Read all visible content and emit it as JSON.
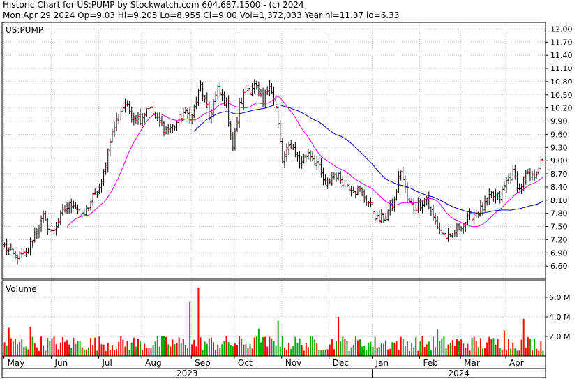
{
  "header": {
    "line1": "Historic Chart for US:PUMP by Stockwatch.com 604.687.1500 - (c) 2024",
    "line2": "Mon Apr 29 2024  Op=9.03  Hi=9.205  Lo=8.955  Cl=9.00  Vol=1,372,033  Year hi=11.37  lo=6.33"
  },
  "chart_data": {
    "type": "ohlc",
    "symbol_label": "US:PUMP",
    "volume_label": "Volume",
    "y_ticks": [
      "12.00",
      "11.70",
      "11.40",
      "11.10",
      "10.80",
      "10.50",
      "10.20",
      "9.90",
      "9.60",
      "9.30",
      "9.00",
      "8.70",
      "8.40",
      "8.10",
      "7.80",
      "7.50",
      "7.20",
      "6.90",
      "6.60"
    ],
    "ylim": [
      6.3,
      12.15
    ],
    "volume_ticks": [
      "6.0 M",
      "4.0 M",
      "2.0 M"
    ],
    "volume_ylim": [
      0,
      7.5
    ],
    "months": [
      "May",
      "Jun",
      "Jul",
      "Aug",
      "Sep",
      "Oct",
      "Nov",
      "Dec",
      "Jan",
      "Feb",
      "Mar",
      "Apr"
    ],
    "years": [
      "2023",
      "2024"
    ],
    "trading_days": 251,
    "month_starts": [
      0,
      22,
      44,
      64,
      87,
      107,
      129,
      151,
      171,
      193,
      212,
      233
    ],
    "anchors": [
      [
        0,
        7.05
      ],
      [
        5,
        6.8
      ],
      [
        10,
        6.85
      ],
      [
        14,
        7.35
      ],
      [
        18,
        7.7
      ],
      [
        22,
        7.35
      ],
      [
        28,
        7.9
      ],
      [
        32,
        8.05
      ],
      [
        36,
        7.7
      ],
      [
        41,
        8.15
      ],
      [
        45,
        8.45
      ],
      [
        49,
        9.5
      ],
      [
        53,
        10.05
      ],
      [
        56,
        10.3
      ],
      [
        59,
        10.05
      ],
      [
        63,
        9.95
      ],
      [
        67,
        10.25
      ],
      [
        71,
        9.9
      ],
      [
        75,
        9.7
      ],
      [
        79,
        9.8
      ],
      [
        83,
        10.1
      ],
      [
        87,
        10.0
      ],
      [
        91,
        10.7
      ],
      [
        95,
        10.0
      ],
      [
        99,
        10.6
      ],
      [
        103,
        10.3
      ],
      [
        106,
        9.3
      ],
      [
        109,
        10.25
      ],
      [
        112,
        10.6
      ],
      [
        116,
        10.7
      ],
      [
        120,
        10.3
      ],
      [
        123,
        10.8
      ],
      [
        126,
        10.2
      ],
      [
        129,
        9.0
      ],
      [
        133,
        9.4
      ],
      [
        137,
        8.95
      ],
      [
        141,
        9.2
      ],
      [
        145,
        8.95
      ],
      [
        149,
        8.4
      ],
      [
        153,
        8.7
      ],
      [
        157,
        8.55
      ],
      [
        161,
        8.4
      ],
      [
        165,
        8.3
      ],
      [
        169,
        8.05
      ],
      [
        173,
        7.65
      ],
      [
        177,
        7.75
      ],
      [
        181,
        8.1
      ],
      [
        184,
        8.8
      ],
      [
        187,
        8.1
      ],
      [
        190,
        7.9
      ],
      [
        193,
        8.05
      ],
      [
        196,
        8.15
      ],
      [
        198,
        7.8
      ],
      [
        201,
        7.5
      ],
      [
        204,
        7.3
      ],
      [
        207,
        7.2
      ],
      [
        210,
        7.45
      ],
      [
        214,
        7.6
      ],
      [
        218,
        7.8
      ],
      [
        222,
        7.9
      ],
      [
        226,
        8.2
      ],
      [
        230,
        8.15
      ],
      [
        233,
        8.55
      ],
      [
        236,
        8.7
      ],
      [
        239,
        8.35
      ],
      [
        242,
        8.65
      ],
      [
        245,
        8.6
      ],
      [
        248,
        8.85
      ],
      [
        250,
        9.0
      ]
    ],
    "volume_spikes": [
      [
        86,
        5.6
      ],
      [
        90,
        7.0
      ],
      [
        127,
        3.6
      ],
      [
        155,
        4.0
      ],
      [
        241,
        3.8
      ],
      [
        2,
        2.9
      ],
      [
        12,
        3.0
      ],
      [
        118,
        2.8
      ],
      [
        201,
        2.7
      ],
      [
        232,
        2.6
      ]
    ],
    "series": [
      {
        "name": "",
        "kind": "ohlc",
        "color": "#000000"
      },
      {
        "name": "",
        "kind": "moving-average-short",
        "color": "#dd00dd",
        "start_day": 29
      },
      {
        "name": "",
        "kind": "moving-average-long",
        "color": "#0000bb",
        "start_day": 88
      }
    ],
    "colors": {
      "up": "#ff0000",
      "down": "#00aa00",
      "bar": "#000000",
      "grid": "#bbbbbb"
    }
  }
}
